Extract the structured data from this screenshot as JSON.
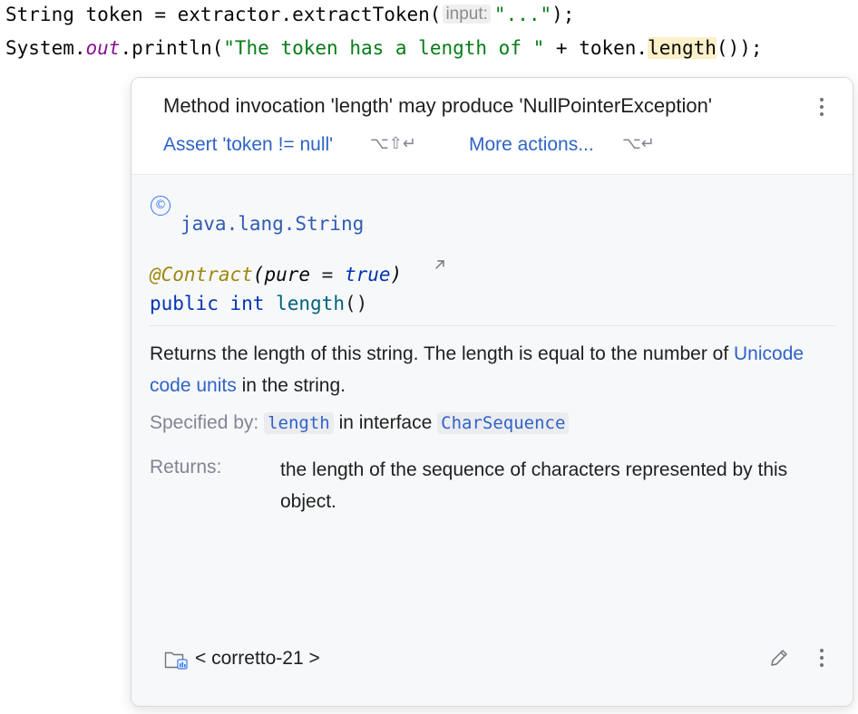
{
  "editor": {
    "line1": {
      "pre": "String token = extractor.extractToken(",
      "hint": "input:",
      "arg": "\"...\"",
      "post": ");"
    },
    "line2": {
      "system": "System.",
      "out": "out",
      "println": ".println(",
      "str": "\"The token has a length of \"",
      "plus": " + token.",
      "method": "length",
      "post": "());"
    }
  },
  "popup": {
    "problem": {
      "message": "Method invocation 'length' may produce 'NullPointerException'",
      "action1_label": "Assert 'token != null'",
      "action1_shortcut": "⌥⇧↵",
      "action2_label": "More actions...",
      "action2_shortcut": "⌥↵"
    },
    "doc": {
      "class_icon": "©",
      "class_name": "java.lang.String",
      "annotation": "@Contract",
      "annotation_open": "(",
      "annotation_param": "pure",
      "annotation_eq": " = ",
      "annotation_value": "true",
      "annotation_close": ")",
      "sig_public": "public",
      "sig_int": "int",
      "sig_method": "length",
      "sig_parens": "()",
      "desc_part1": "Returns the length of this string. The length is equal to the number of ",
      "desc_link": "Unicode code units",
      "desc_part2": " in the string.",
      "specified_label": "Specified by:",
      "specified_method": "length",
      "specified_mid": " in interface ",
      "specified_interface": "CharSequence",
      "returns_label": "Returns:",
      "returns_text": "the length of the sequence of characters represented by this object."
    },
    "footer": {
      "label": "< corretto-21 >"
    }
  },
  "icons": {
    "class": "class-icon",
    "external_link": "external-link-icon",
    "folder": "library-folder-icon",
    "edit": "pencil-icon",
    "more": "kebab-icon"
  },
  "colors": {
    "link": "#2f63c7",
    "keyword": "#0033b3",
    "annotation": "#9e880d",
    "string": "#067d17",
    "field": "#871094",
    "highlight": "#fcf0c8"
  }
}
